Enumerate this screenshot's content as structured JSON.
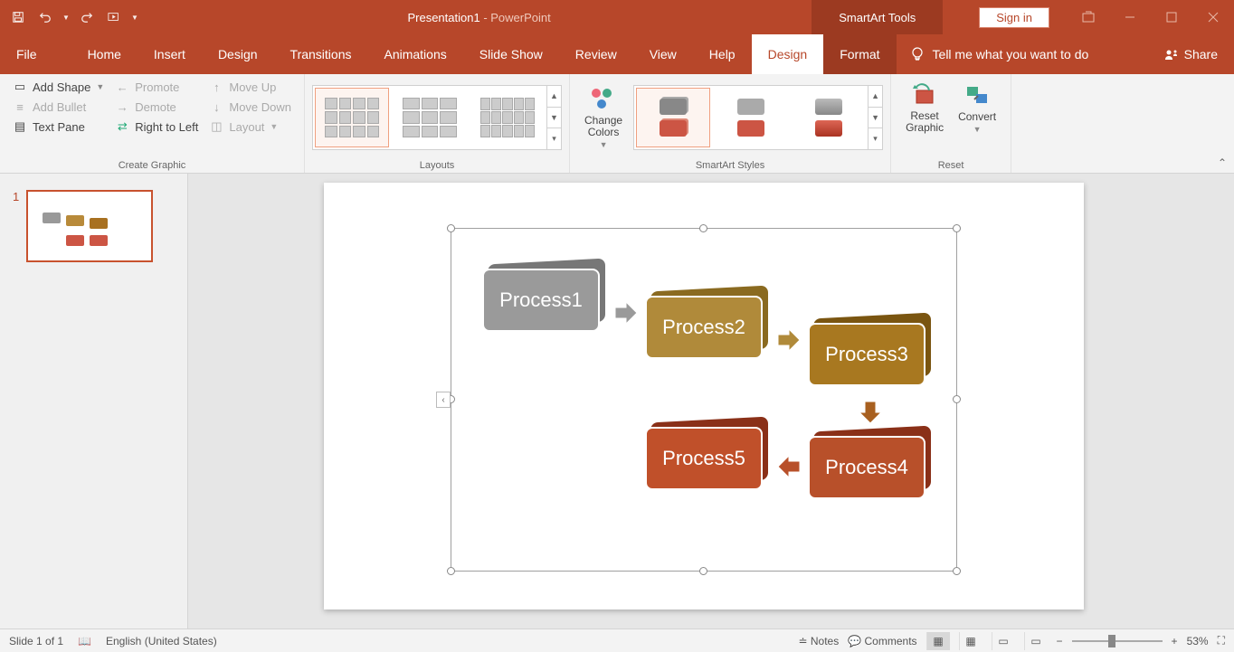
{
  "title": {
    "doc": "Presentation1",
    "sep": "  -  ",
    "app": "PowerPoint"
  },
  "contextTab": "SmartArt Tools",
  "signin": "Sign in",
  "tabs": {
    "file": "File",
    "home": "Home",
    "insert": "Insert",
    "design": "Design",
    "transitions": "Transitions",
    "animations": "Animations",
    "slideshow": "Slide Show",
    "review": "Review",
    "view": "View",
    "help": "Help",
    "sadesign": "Design",
    "saformat": "Format"
  },
  "tellMe": "Tell me what you want to do",
  "share": "Share",
  "createGraphic": {
    "addShape": "Add Shape",
    "addBullet": "Add Bullet",
    "textPane": "Text Pane",
    "promote": "Promote",
    "demote": "Demote",
    "rtl": "Right to Left",
    "moveUp": "Move Up",
    "moveDown": "Move Down",
    "layout": "Layout",
    "label": "Create Graphic"
  },
  "layouts": {
    "label": "Layouts"
  },
  "styles": {
    "changeColors": "Change\nColors",
    "label": "SmartArt Styles"
  },
  "reset": {
    "resetGraphic": "Reset\nGraphic",
    "convert": "Convert",
    "label": "Reset"
  },
  "thumb": {
    "num": "1"
  },
  "smartart": {
    "p1": "Process1",
    "p2": "Process2",
    "p3": "Process3",
    "p4": "Process4",
    "p5": "Process5"
  },
  "status": {
    "slide": "Slide 1 of 1",
    "lang": "English (United States)",
    "notes": "Notes",
    "comments": "Comments",
    "zoom": "53%"
  }
}
